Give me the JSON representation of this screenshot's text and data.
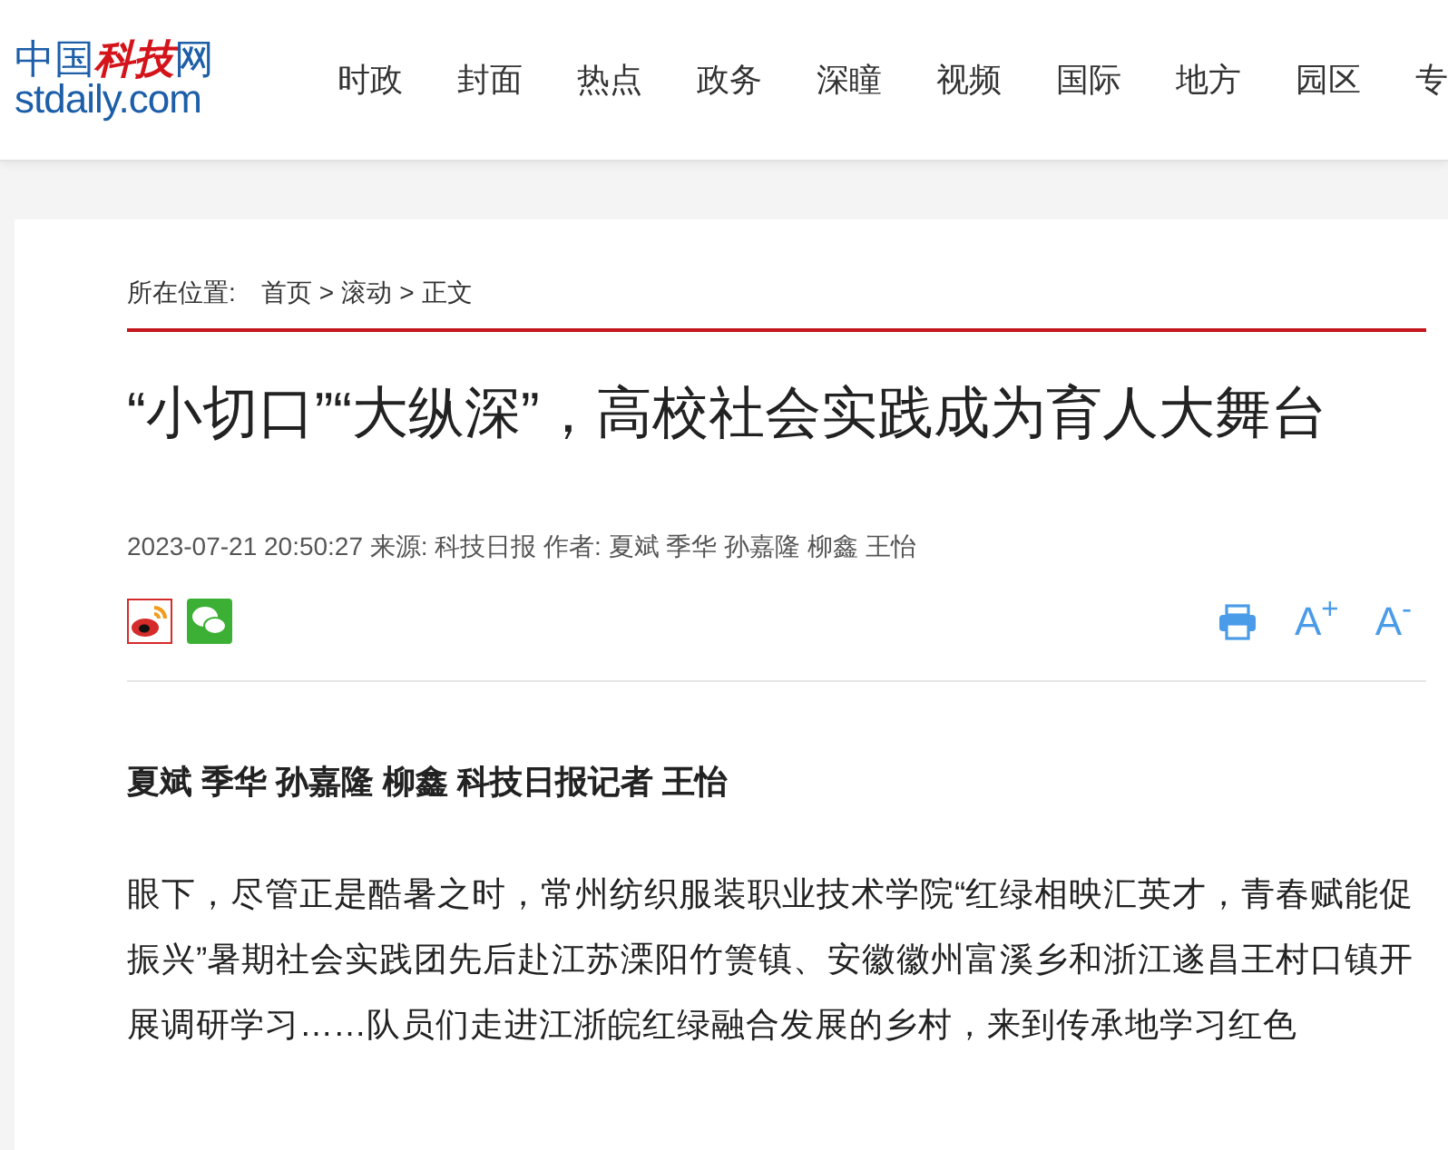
{
  "logo": {
    "prefix": "中国",
    "highlight": "科技",
    "suffix": "网",
    "domain": "stdaily.com"
  },
  "nav": [
    "时政",
    "封面",
    "热点",
    "政务",
    "深瞳",
    "视频",
    "国际",
    "地方",
    "园区",
    "专"
  ],
  "breadcrumb": {
    "label": "所在位置:",
    "items": [
      "首页",
      "滚动",
      "正文"
    ],
    "separator": ">"
  },
  "article": {
    "title": "“小切口”“大纵深”，高校社会实践成为育人大舞台",
    "meta": "2023-07-21 20:50:27 来源: 科技日报 作者: 夏斌 季华 孙嘉隆 柳鑫 王怡",
    "font_buttons": [
      "A$^{+}$",
      "A$^{-}$"
    ],
    "byline": "夏斌 季华 孙嘉隆 柳鑫 科技日报记者 王怡",
    "paragraph": "眼下，尽管正是酷暑之时，常州纺织服装职业技术学院“红绿相映汇英才，青春赋能促振兴”暑期社会实践团先后赴江苏溧阳竹箦镇、安徽徽州富溪乡和浙江遂昌王村口镇开展调研学习……队员们走进江浙皖红绿融合发展的乡村，来到传承地学习红色"
  }
}
